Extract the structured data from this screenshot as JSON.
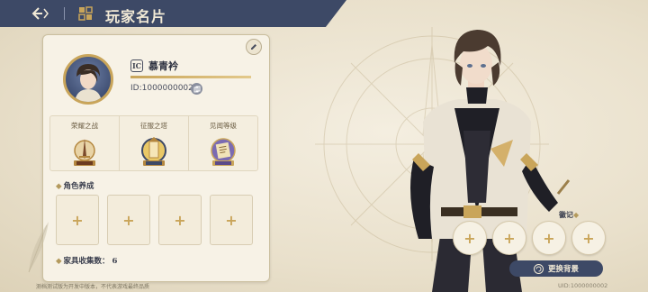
{
  "header": {
    "title": "玩家名片",
    "back_icon": "back-arrow-icon",
    "card_icon": "profile-card-icon"
  },
  "profile": {
    "level_badge": "IC",
    "name": "慕青衿",
    "uid": "ID:1000000002"
  },
  "honors": [
    {
      "label": "荣耀之战",
      "emblem": "sword-emblem"
    },
    {
      "label": "征服之塔",
      "emblem": "tower-emblem"
    },
    {
      "label": "见闻等级",
      "emblem": "scroll-emblem"
    }
  ],
  "character_training": {
    "title": "角色养成",
    "slots": [
      "+",
      "+",
      "+",
      "+"
    ]
  },
  "furniture": {
    "label": "家具收集数：",
    "count": "6"
  },
  "disclaimer": "测档测试版为开发中版本，不代表游戏最终品质",
  "badges": {
    "title": "徽记",
    "slots": [
      "+",
      "+",
      "+",
      "+"
    ]
  },
  "change_background_label": "更换背景",
  "footer_uid": "UID:1000000002",
  "colors": {
    "navy": "#3d4966",
    "gold": "#c9a55a",
    "parchment": "#f7f2e6"
  }
}
